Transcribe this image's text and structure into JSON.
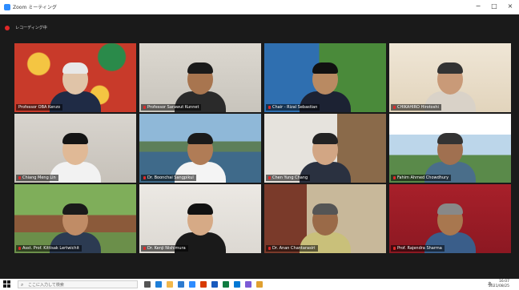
{
  "window": {
    "title": "Zoom ミーティング",
    "minimize": "−",
    "maximize": "□",
    "close": "×"
  },
  "meeting": {
    "recording_label": "レコーディング中"
  },
  "participants": [
    {
      "name": "Professor OBA Kenzo",
      "muted": false
    },
    {
      "name": "Professor Sarawut Kunnet",
      "muted": true
    },
    {
      "name": "Chair - Rizal Sebastian",
      "muted": true
    },
    {
      "name": "CHIKAHIRO Hirotoshi",
      "muted": true
    },
    {
      "name": "Chiang Meng Lin",
      "muted": true
    },
    {
      "name": "Dr. Boonchai Sangpikul",
      "muted": true
    },
    {
      "name": "Chen Yung Chang",
      "muted": true
    },
    {
      "name": "Fahim Ahmed Chowdhury",
      "muted": true
    },
    {
      "name": "Asst. Prof. Kittisak Lertwichit",
      "muted": true
    },
    {
      "name": "Dr. Kenji Nishimura",
      "muted": true
    },
    {
      "name": "Dr. Anan Chantarasiri",
      "muted": true
    },
    {
      "name": "Prof. Rajendra Sharma",
      "muted": true
    }
  ],
  "taskbar": {
    "search_placeholder": "ここに入力して検索",
    "ime": "あ",
    "time": "16:07",
    "date": "2021/08/25"
  }
}
